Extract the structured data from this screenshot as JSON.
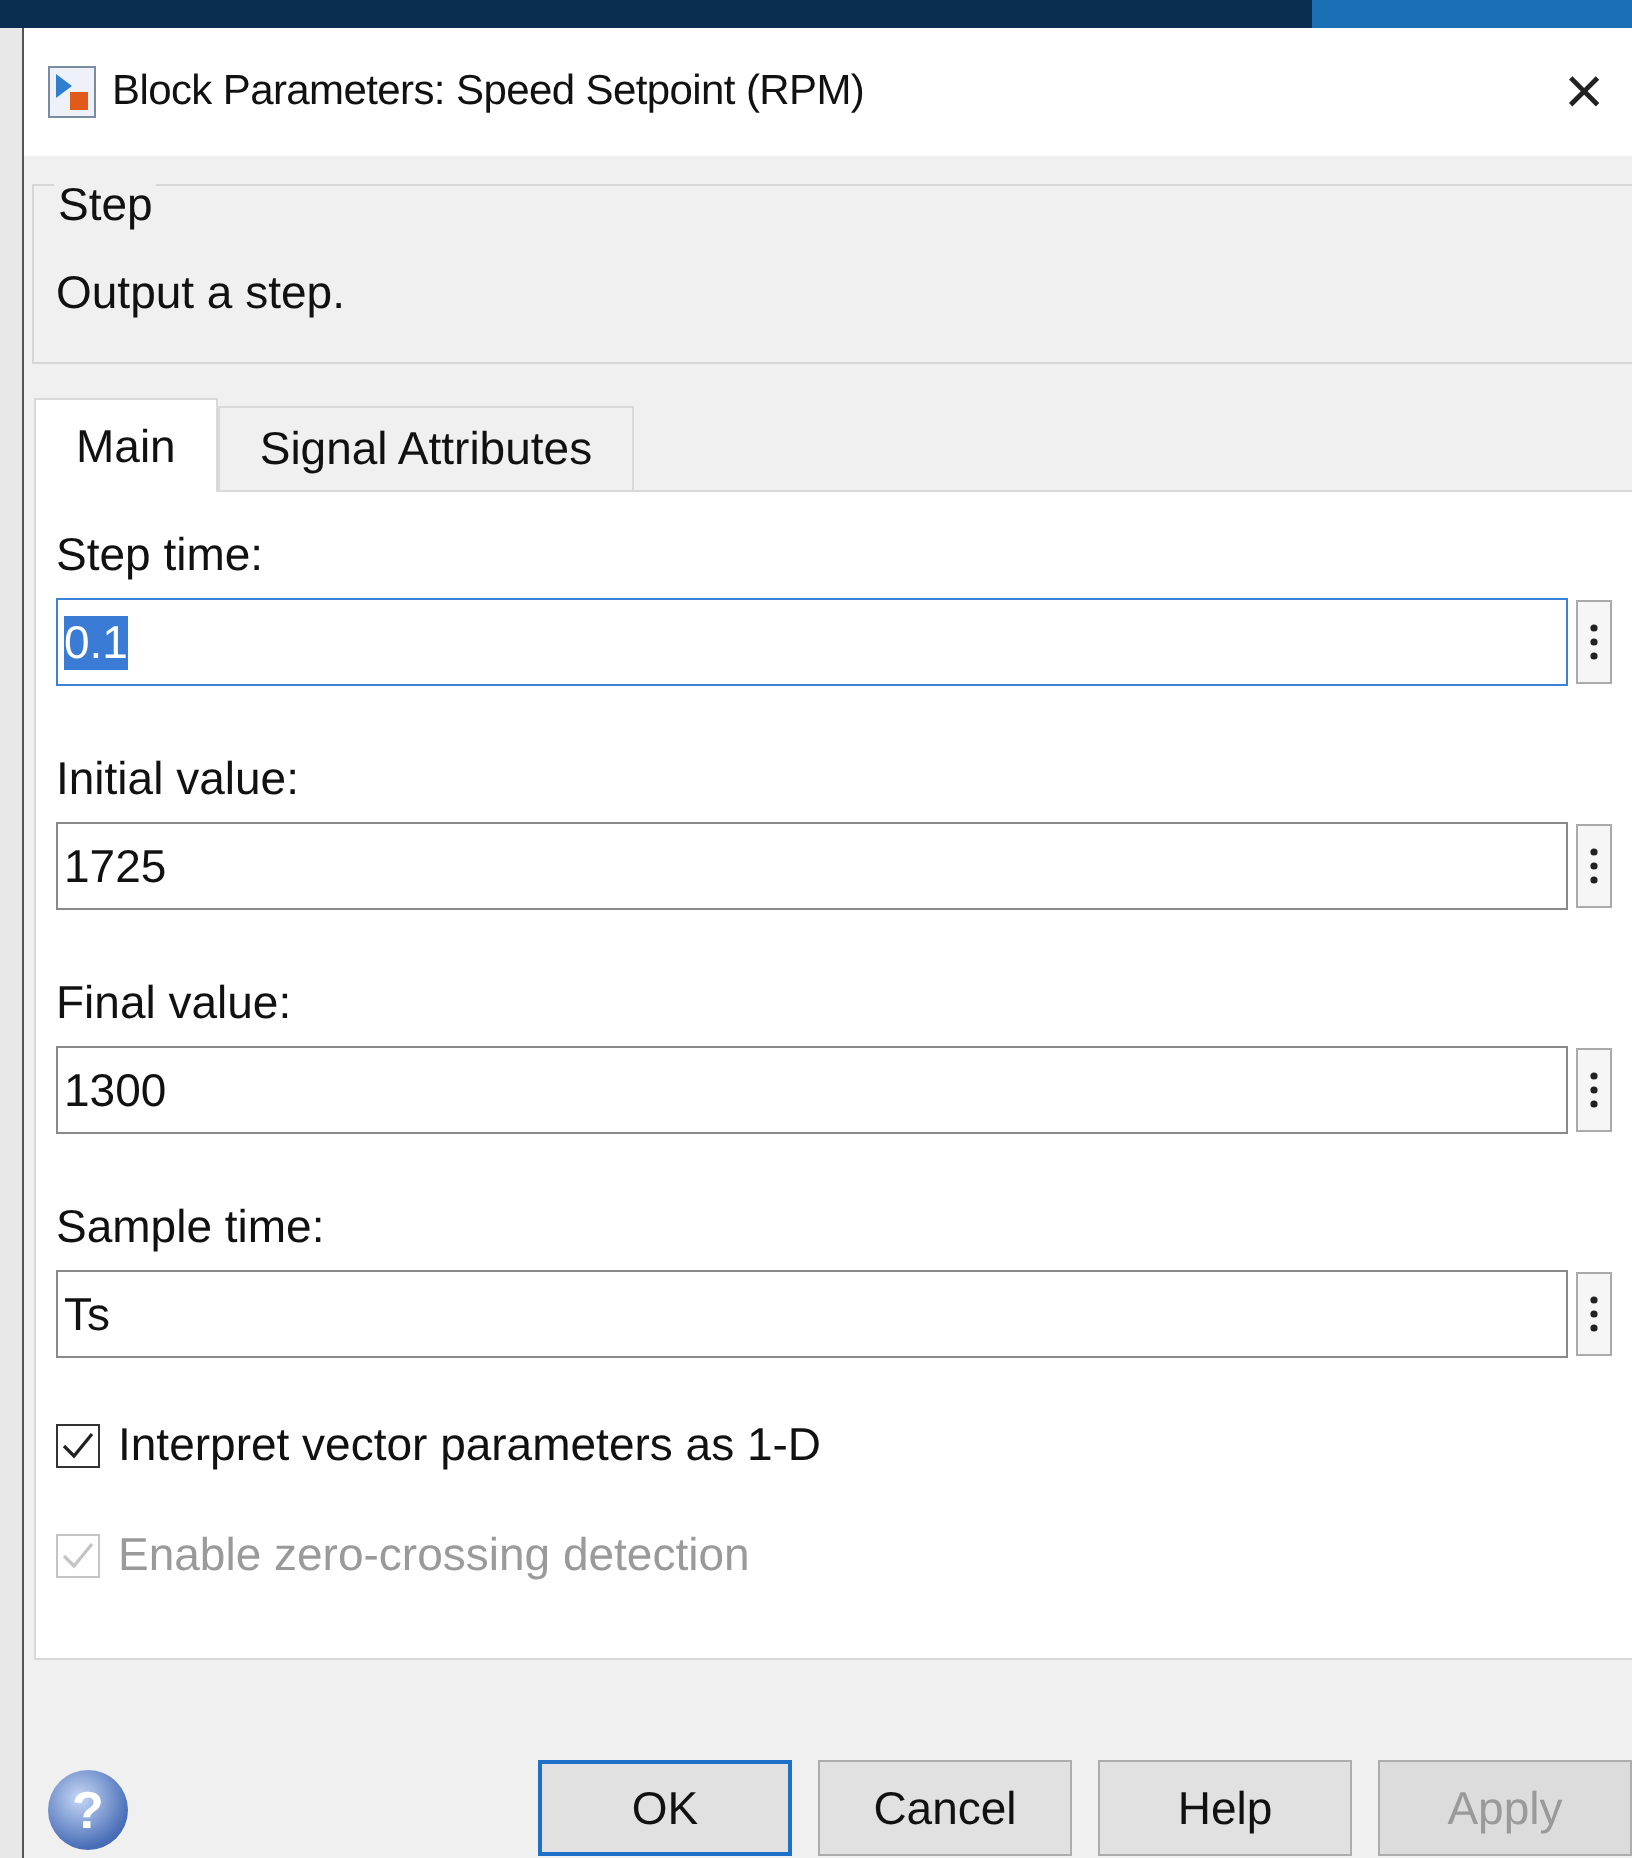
{
  "window": {
    "title": "Block Parameters: Speed Setpoint (RPM)",
    "close_glyph": "×"
  },
  "group": {
    "legend": "Step",
    "description": "Output a step."
  },
  "tabs": [
    {
      "label": "Main",
      "selected": true
    },
    {
      "label": "Signal Attributes",
      "selected": false
    }
  ],
  "parameters": [
    {
      "label": "Step time:",
      "value": "0.1",
      "focused": true,
      "text_selected": true
    },
    {
      "label": "Initial value:",
      "value": "1725",
      "focused": false,
      "text_selected": false
    },
    {
      "label": "Final value:",
      "value": "1300",
      "focused": false,
      "text_selected": false
    },
    {
      "label": "Sample time:",
      "value": "Ts",
      "focused": false,
      "text_selected": false
    }
  ],
  "options": [
    {
      "label": "Interpret vector parameters as 1-D",
      "checked": true,
      "disabled": false
    },
    {
      "label": "Enable zero-crossing detection",
      "checked": true,
      "disabled": true
    }
  ],
  "help_glyph": "?",
  "buttons": [
    {
      "label": "OK",
      "default": true,
      "disabled": false
    },
    {
      "label": "Cancel",
      "default": false,
      "disabled": false
    },
    {
      "label": "Help",
      "default": false,
      "disabled": false
    },
    {
      "label": "Apply",
      "default": false,
      "disabled": true
    }
  ]
}
